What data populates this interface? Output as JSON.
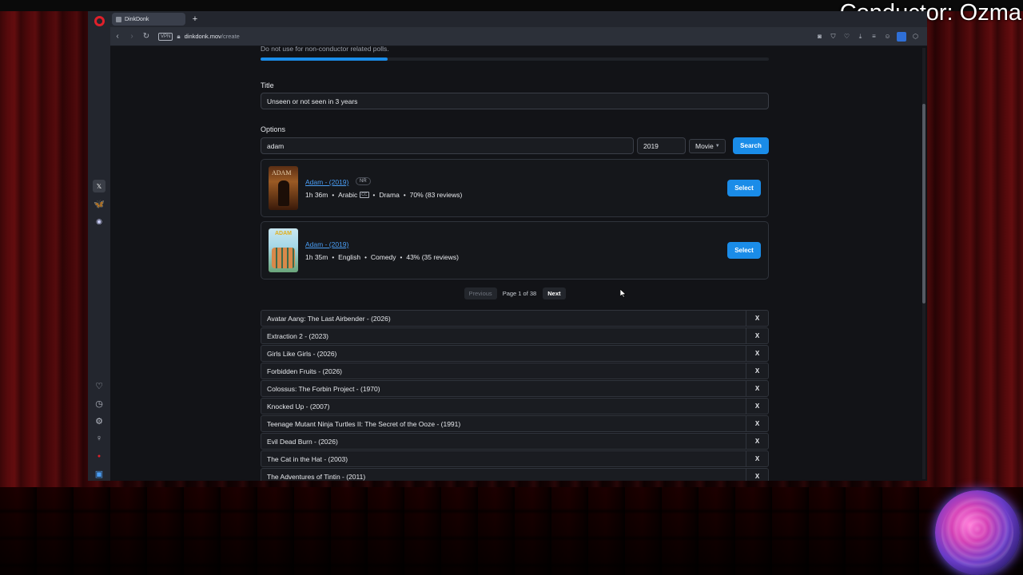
{
  "overlay": {
    "text": "Conductor: Ozma"
  },
  "browser": {
    "tab_title": "DinkDonk",
    "new_tab": "+",
    "vpn": "VPN",
    "url_host": "dinkdonk.mov",
    "url_path": "/create"
  },
  "form": {
    "note": "Do not use for non-conductor related polls.",
    "progress_fraction": 0.25,
    "title_label": "Title",
    "title_value": "Unseen or not seen in 3 years",
    "options_label": "Options",
    "search_value": "adam",
    "year_value": "2019",
    "type_value": "Movie",
    "search_button": "Search"
  },
  "results": [
    {
      "title": "Adam - (2019)",
      "rating": "NR",
      "runtime": "1h 36m",
      "language": "Arabic",
      "cc": "CC",
      "genre": "Drama",
      "score": "70% (83 reviews)",
      "poster_text": "ADAM",
      "select": "Select"
    },
    {
      "title": "Adam - (2019)",
      "runtime": "1h 35m",
      "language": "English",
      "genre": "Comedy",
      "score": "43% (35 reviews)",
      "poster_text": "ADAM",
      "select": "Select"
    }
  ],
  "pager": {
    "previous": "Previous",
    "page_text": "Page 1 of 38",
    "next": "Next"
  },
  "selected": {
    "remove": "X",
    "items": [
      "Avatar Aang: The Last Airbender - (2026)",
      "Extraction 2 - (2023)",
      "Girls Like Girls - (2026)",
      "Forbidden Fruits - (2026)",
      "Colossus: The Forbin Project - (1970)",
      "Knocked Up - (2007)",
      "Teenage Mutant Ninja Turtles II: The Secret of the Ooze - (1991)",
      "Evil Dead Burn - (2026)",
      "The Cat in the Hat - (2003)",
      "The Adventures of Tintin - (2011)"
    ]
  },
  "icons": {
    "rail_top": [
      "x-icon",
      "bluesky-icon",
      "discord-icon"
    ],
    "rail_bottom": [
      "heart-icon",
      "history-icon",
      "settings-icon",
      "lightbulb-icon",
      "record-icon",
      "extension-icon",
      "more-icon"
    ],
    "toolbar": [
      "camera-icon",
      "shield-icon",
      "heart-icon",
      "download-icon",
      "menu-icon",
      "profile-icon"
    ]
  }
}
